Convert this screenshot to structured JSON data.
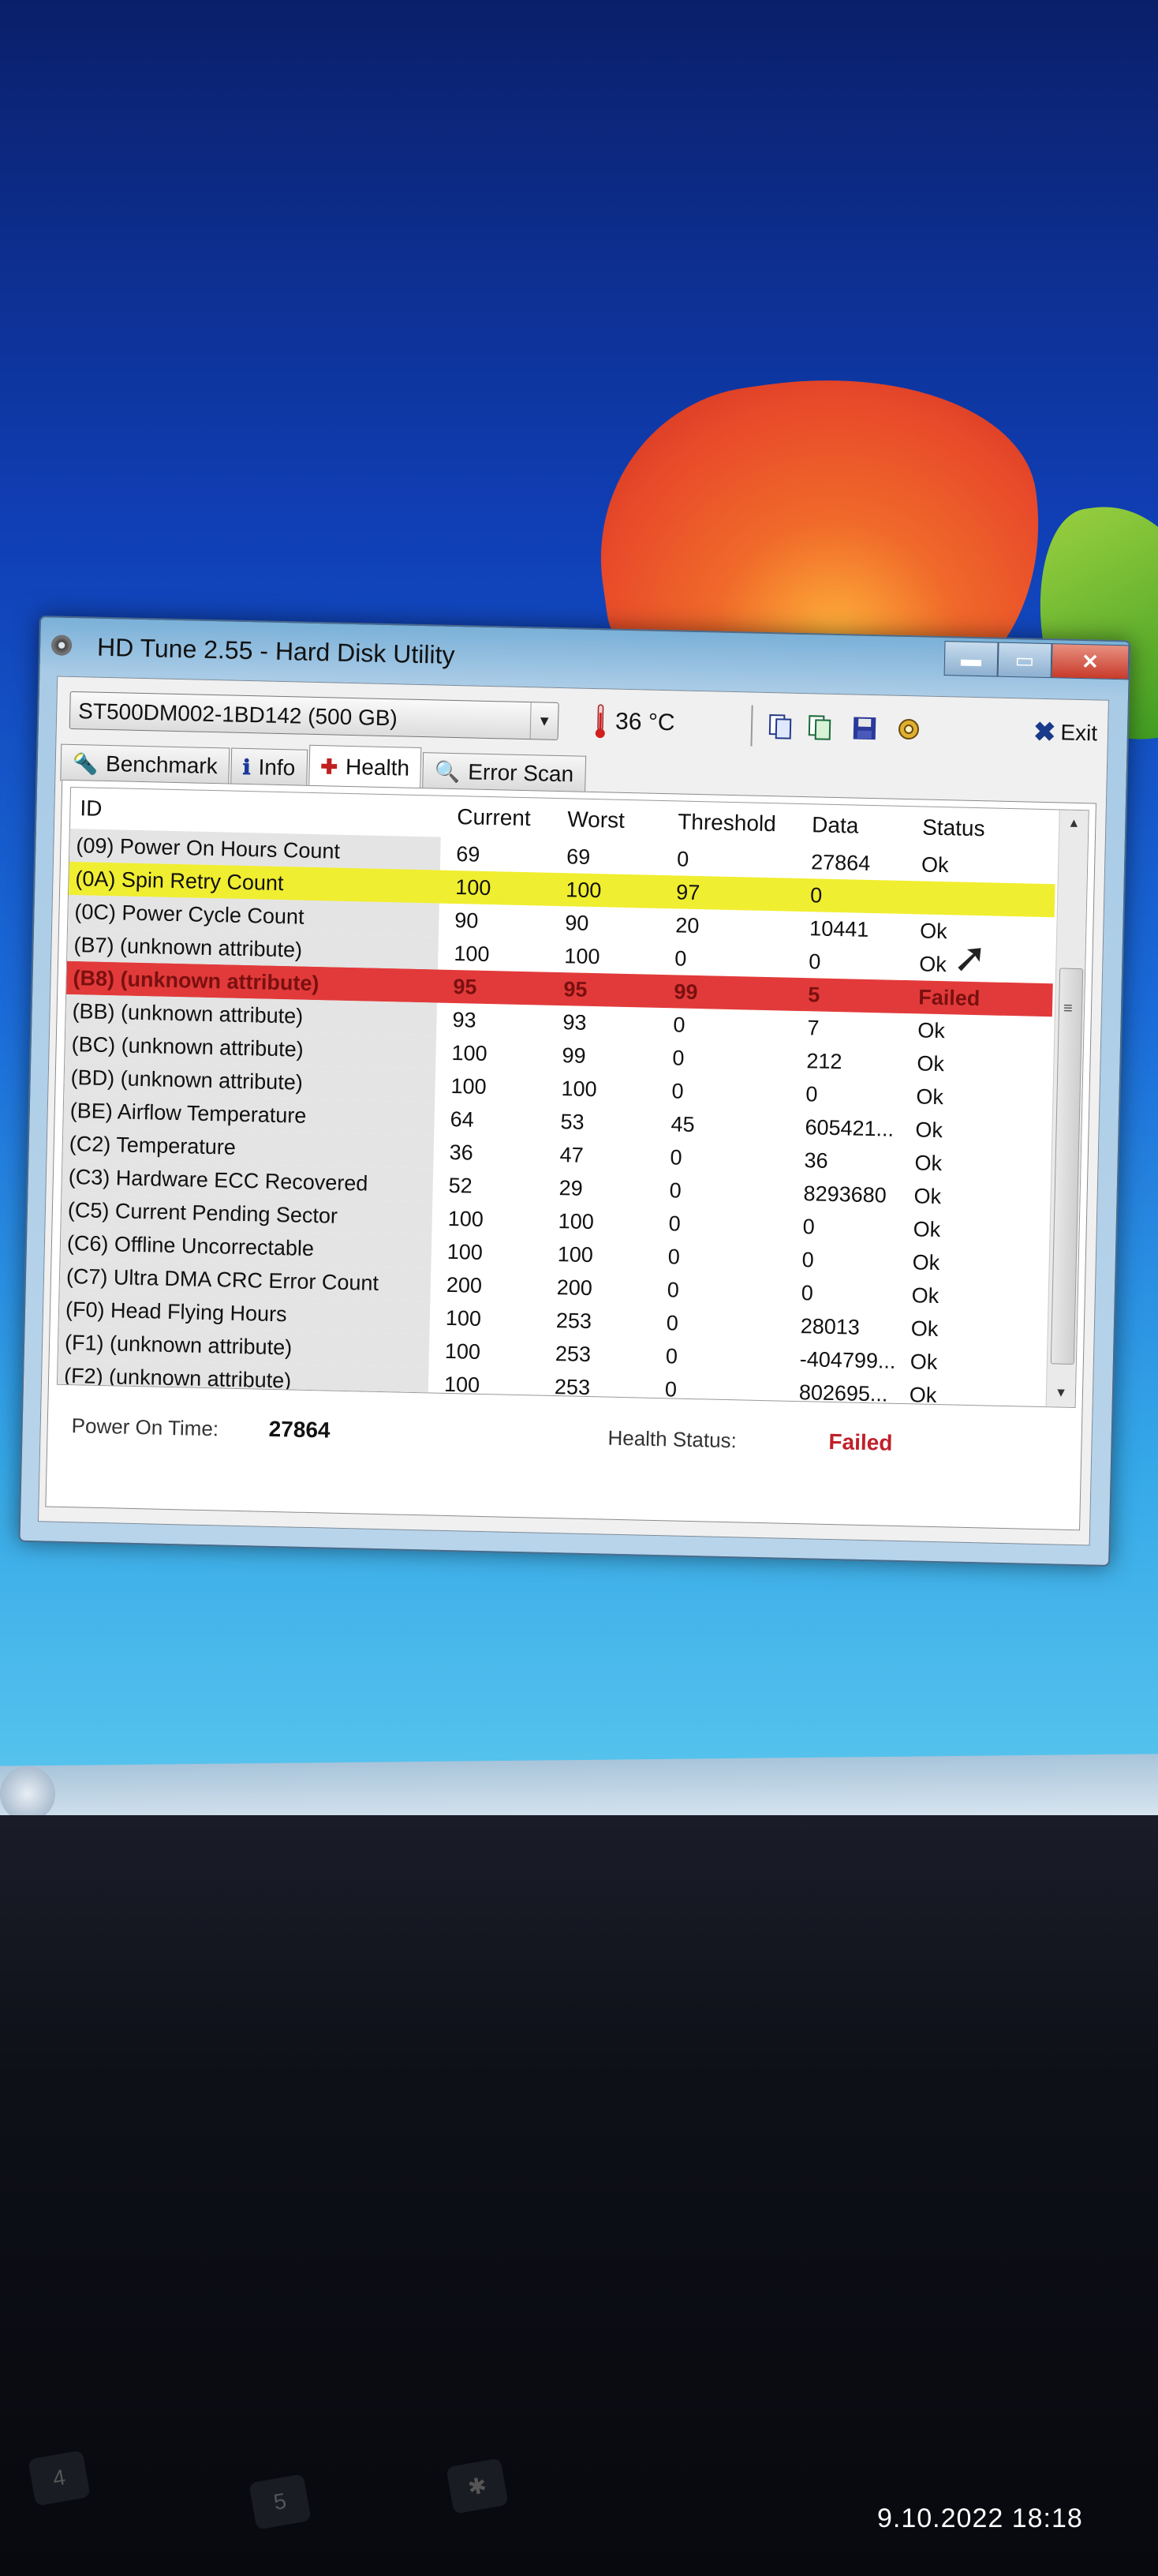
{
  "window": {
    "title": "HD Tune 2.55 - Hard Disk Utility",
    "minimize_glyph": "▬",
    "maximize_glyph": "▭",
    "close_glyph": "✕"
  },
  "toolbar": {
    "drive": "ST500DM002-1BD142 (500 GB)",
    "temperature": "36 °C",
    "exit_label": "Exit",
    "icons": [
      "copy-icon",
      "copy-all-icon",
      "save-icon",
      "options-icon"
    ]
  },
  "tabs": [
    {
      "label": "Benchmark",
      "icon": "benchmark-icon"
    },
    {
      "label": "Info",
      "icon": "info-icon"
    },
    {
      "label": "Health",
      "icon": "health-icon",
      "active": true
    },
    {
      "label": "Error Scan",
      "icon": "magnifier-icon"
    }
  ],
  "table": {
    "columns": [
      "ID",
      "Current",
      "Worst",
      "Threshold",
      "Data",
      "Status"
    ],
    "rows": [
      {
        "id": "(09) Power On Hours Count",
        "current": "69",
        "worst": "69",
        "threshold": "0",
        "data": "27864",
        "status": "Ok",
        "state": "normal"
      },
      {
        "id": "(0A) Spin Retry Count",
        "current": "100",
        "worst": "100",
        "threshold": "97",
        "data": "0",
        "status": "",
        "state": "warning"
      },
      {
        "id": "(0C) Power Cycle Count",
        "current": "90",
        "worst": "90",
        "threshold": "20",
        "data": "10441",
        "status": "Ok",
        "state": "normal"
      },
      {
        "id": "(B7) (unknown attribute)",
        "current": "100",
        "worst": "100",
        "threshold": "0",
        "data": "0",
        "status": "Ok",
        "state": "normal"
      },
      {
        "id": "(B8) (unknown attribute)",
        "current": "95",
        "worst": "95",
        "threshold": "99",
        "data": "5",
        "status": "Failed",
        "state": "failed"
      },
      {
        "id": "(BB) (unknown attribute)",
        "current": "93",
        "worst": "93",
        "threshold": "0",
        "data": "7",
        "status": "Ok",
        "state": "normal"
      },
      {
        "id": "(BC) (unknown attribute)",
        "current": "100",
        "worst": "99",
        "threshold": "0",
        "data": "212",
        "status": "Ok",
        "state": "normal"
      },
      {
        "id": "(BD) (unknown attribute)",
        "current": "100",
        "worst": "100",
        "threshold": "0",
        "data": "0",
        "status": "Ok",
        "state": "normal"
      },
      {
        "id": "(BE) Airflow Temperature",
        "current": "64",
        "worst": "53",
        "threshold": "45",
        "data": "605421...",
        "status": "Ok",
        "state": "normal"
      },
      {
        "id": "(C2) Temperature",
        "current": "36",
        "worst": "47",
        "threshold": "0",
        "data": "36",
        "status": "Ok",
        "state": "normal"
      },
      {
        "id": "(C3) Hardware ECC Recovered",
        "current": "52",
        "worst": "29",
        "threshold": "0",
        "data": "8293680",
        "status": "Ok",
        "state": "normal"
      },
      {
        "id": "(C5) Current Pending Sector",
        "current": "100",
        "worst": "100",
        "threshold": "0",
        "data": "0",
        "status": "Ok",
        "state": "normal"
      },
      {
        "id": "(C6) Offline Uncorrectable",
        "current": "100",
        "worst": "100",
        "threshold": "0",
        "data": "0",
        "status": "Ok",
        "state": "normal"
      },
      {
        "id": "(C7) Ultra DMA CRC Error Count",
        "current": "200",
        "worst": "200",
        "threshold": "0",
        "data": "0",
        "status": "Ok",
        "state": "normal"
      },
      {
        "id": "(F0) Head Flying Hours",
        "current": "100",
        "worst": "253",
        "threshold": "0",
        "data": "28013",
        "status": "Ok",
        "state": "normal"
      },
      {
        "id": "(F1) (unknown attribute)",
        "current": "100",
        "worst": "253",
        "threshold": "0",
        "data": "-404799...",
        "status": "Ok",
        "state": "normal"
      },
      {
        "id": "(F2) (unknown attribute)",
        "current": "100",
        "worst": "253",
        "threshold": "0",
        "data": "802695...",
        "status": "Ok",
        "state": "normal"
      }
    ]
  },
  "footer": {
    "power_on_label": "Power On Time:",
    "power_on_value": "27864",
    "health_label": "Health Status:",
    "health_value": "Failed"
  },
  "colors": {
    "warning_row": "#f0ee30",
    "failed_row": "#e23a3a",
    "failed_text": "#c0202a"
  },
  "photo": {
    "timestamp": "9.10.2022 18:18"
  }
}
